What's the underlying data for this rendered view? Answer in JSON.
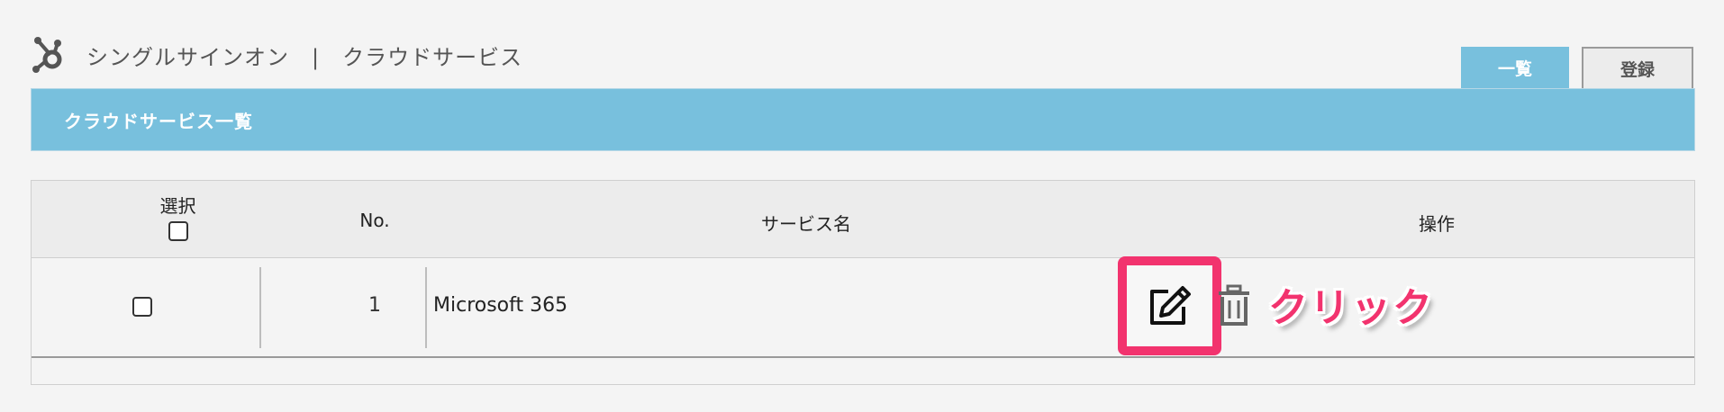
{
  "header": {
    "title": "シングルサインオン　|　クラウドサービス",
    "logo_icon": "hub-logo-icon"
  },
  "tabs": [
    {
      "label": "一覧",
      "active": true
    },
    {
      "label": "登録",
      "active": false
    }
  ],
  "section": {
    "title": "クラウドサービス一覧"
  },
  "table": {
    "columns": {
      "select": "選択",
      "no": "No.",
      "service_name": "サービス名",
      "operations": "操作"
    },
    "rows": [
      {
        "no": "1",
        "service_name": "Microsoft 365",
        "checked": false
      }
    ]
  },
  "actions": {
    "edit_icon": "edit-icon",
    "delete_icon": "trash-icon"
  },
  "annotation": {
    "label": "クリック"
  },
  "colors": {
    "accent": "#78c0dd",
    "highlight": "#f2336e",
    "background": "#f4f4f4"
  }
}
